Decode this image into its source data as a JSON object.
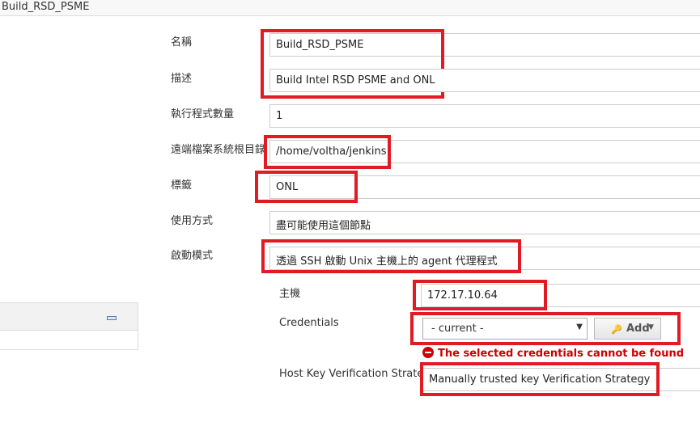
{
  "header": {
    "title": "Build_RSD_PSME"
  },
  "form": {
    "name_label": "名稱",
    "name_value": "Build_RSD_PSME",
    "desc_label": "描述",
    "desc_value": "Build Intel RSD PSME and ONL",
    "executors_label": "執行程式數量",
    "executors_value": "1",
    "remote_fs_label": "遠端檔案系統根目錄",
    "remote_fs_value": "/home/voltha/jenkins",
    "labels_label": "標籤",
    "labels_value": "ONL",
    "usage_label": "使用方式",
    "usage_value": "盡可能使用這個節點",
    "launch_label": "啟動模式",
    "launch_value": "透過 SSH 啟動 Unix 主機上的 agent 代理程式",
    "host_label": "主機",
    "host_value": "172.17.10.64",
    "credentials_label": "Credentials",
    "credentials_selected": "- current -",
    "add_label": "Add",
    "error_message": "The selected credentials cannot be found",
    "hkvs_label": "Host Key Verification Strategy",
    "hkvs_value": "Manually trusted key Verification Strategy"
  },
  "colors": {
    "highlight": "#e01b24",
    "error": "#cc0000"
  }
}
